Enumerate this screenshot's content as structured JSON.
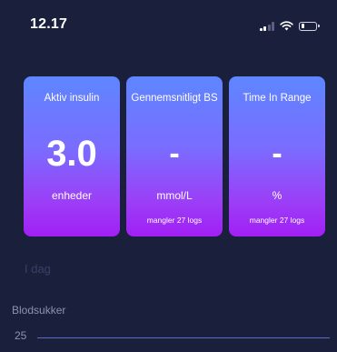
{
  "status_bar": {
    "time": "12.17"
  },
  "cards": [
    {
      "title": "Aktiv insulin",
      "value": "3.0",
      "unit": "enheder",
      "note": ""
    },
    {
      "title": "Gennemsnitligt BS",
      "value": "-",
      "unit": "mmol/L",
      "note": "mangler 27 logs"
    },
    {
      "title": "Time In Range",
      "value": "-",
      "unit": "%",
      "note": "mangler 27 logs"
    }
  ],
  "section_today": "I dag",
  "section_blood_sugar": "Blodsukker",
  "chart": {
    "y_tick_top": "25"
  },
  "colors": {
    "background": "#1a1f3c",
    "card_top": "#5e86ff",
    "card_bottom": "#a21ff5"
  }
}
